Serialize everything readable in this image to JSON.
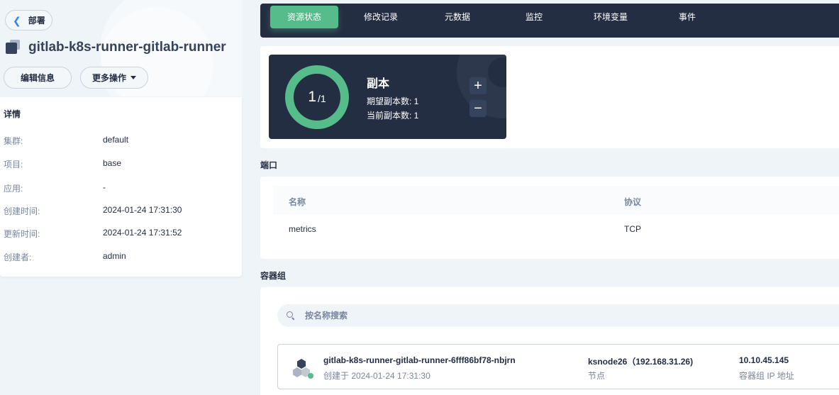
{
  "header": {
    "back_label": "部署",
    "title": "gitlab-k8s-runner-gitlab-runner",
    "edit_label": "编辑信息",
    "more_label": "更多操作"
  },
  "details": {
    "heading": "详情",
    "rows": [
      {
        "key": "集群:",
        "value": "default"
      },
      {
        "key": "项目:",
        "value": "base"
      },
      {
        "key": "应用:",
        "value": "-"
      },
      {
        "key": "创建时间:",
        "value": "2024-01-24 17:31:30"
      },
      {
        "key": "更新时间:",
        "value": "2024-01-24 17:31:52"
      },
      {
        "key": "创建者:",
        "value": "admin"
      }
    ]
  },
  "tabs": [
    {
      "label": "资源状态",
      "active": true
    },
    {
      "label": "修改记录",
      "active": false
    },
    {
      "label": "元数据",
      "active": false
    },
    {
      "label": "监控",
      "active": false
    },
    {
      "label": "环境变量",
      "active": false
    },
    {
      "label": "事件",
      "active": false
    }
  ],
  "replicas": {
    "current": "1",
    "desired_display": "/1",
    "title": "副本",
    "desired_line": "期望副本数: 1",
    "current_line": "当前副本数: 1",
    "plus": "+",
    "minus": "−"
  },
  "ports": {
    "section_title": "端口",
    "headers": [
      "名称",
      "协议"
    ],
    "rows": [
      [
        "metrics",
        "TCP"
      ]
    ]
  },
  "pods": {
    "section_title": "容器组",
    "search_placeholder": "按名称搜索",
    "items": [
      {
        "name": "gitlab-k8s-runner-gitlab-runner-6fff86bf78-nbjrn",
        "created": "创建于 2024-01-24 17:31:30",
        "node": "ksnode26（192.168.31.26)",
        "node_label": "节点",
        "ip": "10.10.45.145",
        "ip_label": "容器组 IP 地址",
        "status_color": "#55bc8a"
      }
    ]
  },
  "colors": {
    "accent": "#55bc8a",
    "dark": "#242e42",
    "background": "#eff4f9"
  }
}
